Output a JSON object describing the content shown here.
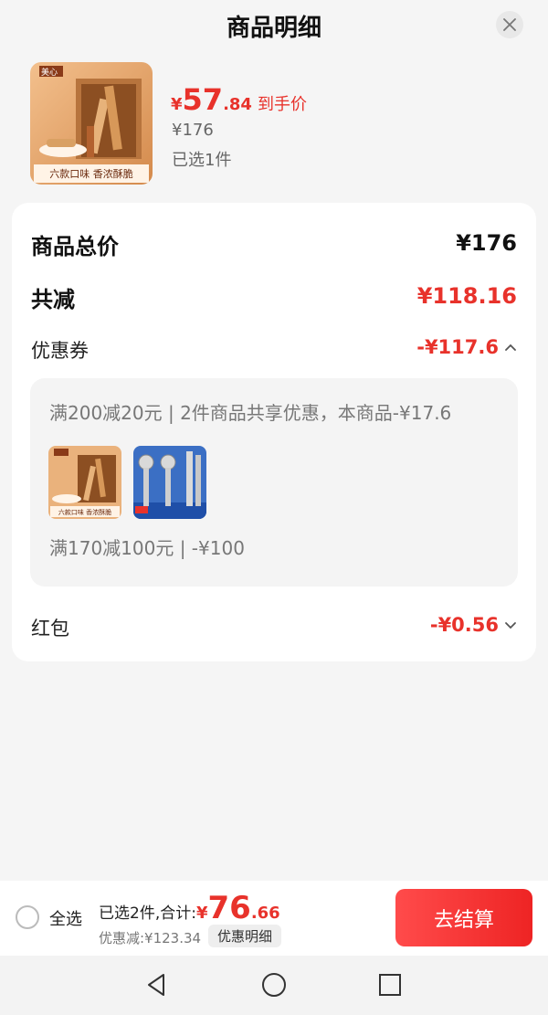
{
  "header": {
    "title": "商品明细"
  },
  "product": {
    "thumb_text": "六款口味 香浓酥脆",
    "brand": "美心",
    "price_symbol": "¥",
    "price_int": "57",
    "price_dec": ".84",
    "price_tag": "到手价",
    "original_price": "¥176",
    "selected": "已选1件"
  },
  "summary": {
    "total_label": "商品总价",
    "total_value": "¥176",
    "reduce_label": "共减",
    "reduce_value": "¥118.16",
    "coupon_label": "优惠券",
    "coupon_value": "-¥117.6",
    "coupon_detail_1": "满200减20元 | 2件商品共享优惠，本商品-¥17.6",
    "mini_thumb_text": "六款口味 香浓酥脆",
    "coupon_detail_2": "满170减100元 | -¥100",
    "redpacket_label": "红包",
    "redpacket_value": "-¥0.56"
  },
  "bottom": {
    "select_all": "全选",
    "selected_label": "已选2件,合计:",
    "symbol": "¥",
    "total_int": "76",
    "total_dec": ".66",
    "discount_text": "优惠减:¥123.34",
    "detail_button": "优惠明细",
    "checkout": "去结算"
  },
  "colors": {
    "accent": "#e8322b"
  },
  "icons": [
    "close-icon",
    "chevron-up-icon",
    "chevron-down-icon",
    "back-triangle-icon",
    "home-circle-icon",
    "recent-square-icon"
  ]
}
